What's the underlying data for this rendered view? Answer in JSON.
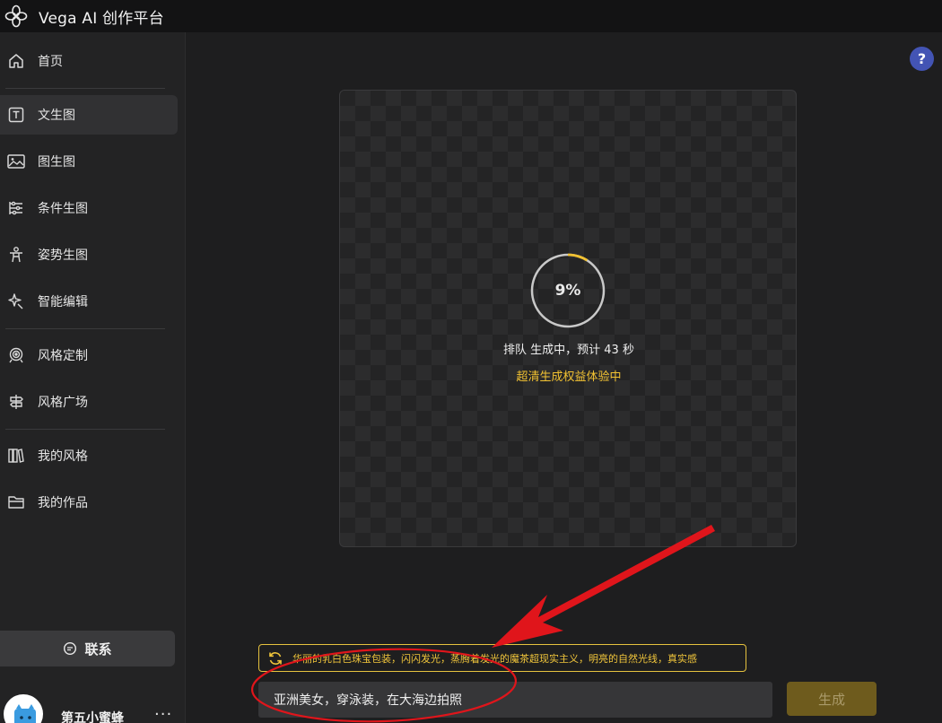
{
  "app": {
    "title": "Vega AI 创作平台",
    "logo_icon": "flower-logo-icon"
  },
  "sidebar": {
    "items": [
      {
        "label": "首页",
        "icon": "home-icon"
      },
      {
        "label": "文生图",
        "icon": "text-box-icon",
        "active": true
      },
      {
        "label": "图生图",
        "icon": "image-icon"
      },
      {
        "label": "条件生图",
        "icon": "sliders-icon"
      },
      {
        "label": "姿势生图",
        "icon": "pose-figure-icon"
      },
      {
        "label": "智能编辑",
        "icon": "sparkle-edit-icon"
      },
      {
        "label": "风格定制",
        "icon": "target-icon"
      },
      {
        "label": "风格广场",
        "icon": "signpost-icon"
      },
      {
        "label": "我的风格",
        "icon": "books-icon"
      },
      {
        "label": "我的作品",
        "icon": "folder-icon"
      }
    ],
    "contact_label": "联系",
    "user": {
      "name": "第五小蜜蜂",
      "more": "···"
    }
  },
  "help": {
    "label": "?"
  },
  "generation": {
    "progress_percent": 9,
    "progress_text": "9%",
    "status_text": "排队 生成中，预计 43 秒",
    "vip_text": "超清生成权益体验中"
  },
  "suggestion": {
    "text": "华丽的乳白色珠宝包装，闪闪发光，蒸腾着发光的魔茶超现实主义，明亮的自然光线，真实感"
  },
  "prompt": {
    "value": "亚洲美女，穿泳装，在大海边拍照"
  },
  "generate_button": {
    "label": "生成"
  },
  "colors": {
    "accent_yellow": "#f2c232",
    "annotation_red": "#e0151b",
    "help_blue": "#4354b4"
  }
}
